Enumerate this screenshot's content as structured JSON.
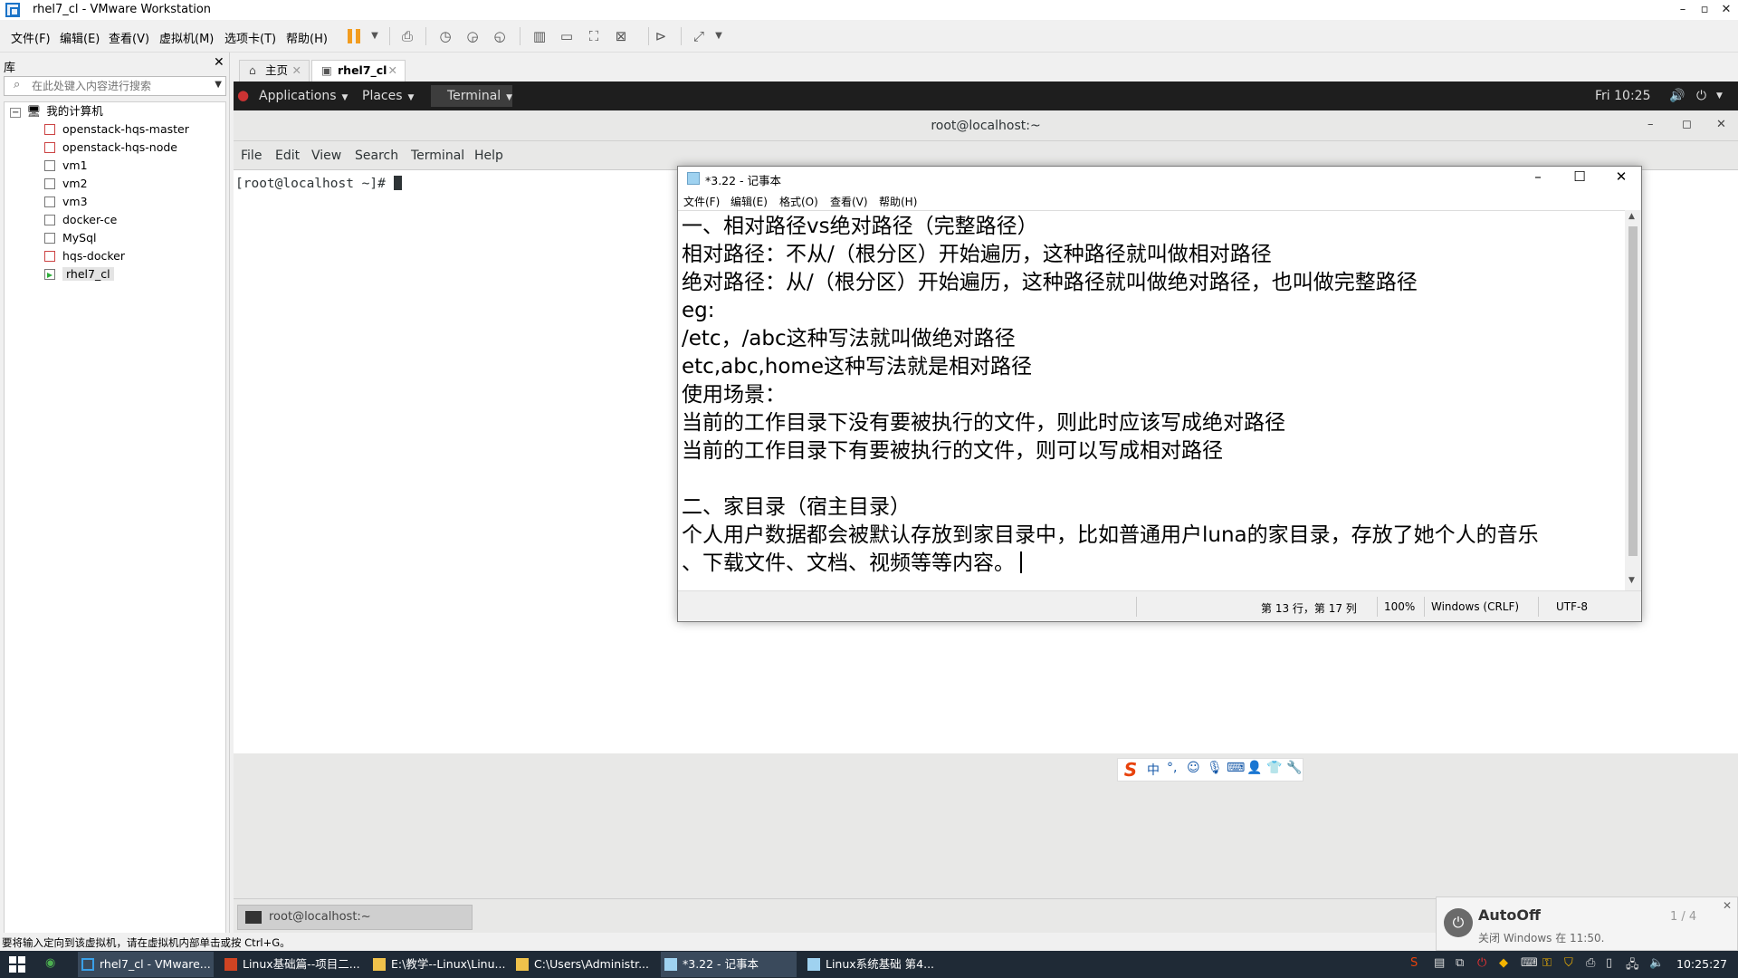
{
  "window": {
    "title": "rhel7_cl - VMware Workstation"
  },
  "menubar": [
    "文件(F)",
    "编辑(E)",
    "查看(V)",
    "虚拟机(M)",
    "选项卡(T)",
    "帮助(H)"
  ],
  "library": {
    "title": "库",
    "search_placeholder": "在此处键入内容进行搜索",
    "root": "我的计算机",
    "vms": [
      "openstack-hqs-master",
      "openstack-hqs-node",
      "vm1",
      "vm2",
      "vm3",
      "docker-ce",
      "MySql",
      "hqs-docker",
      "rhel7_cl"
    ]
  },
  "tabs": {
    "home": "主页",
    "vm": "rhel7_cl"
  },
  "gnome": {
    "applications": "Applications",
    "places": "Places",
    "terminal": "Terminal",
    "clock": "Fri 10:25"
  },
  "terminal": {
    "title": "root@localhost:~",
    "menu": [
      "File",
      "Edit",
      "View",
      "Search",
      "Terminal",
      "Help"
    ],
    "prompt": "[root@localhost ~]# "
  },
  "notepad": {
    "title": "*3.22 - 记事本",
    "menu": [
      "文件(F)",
      "编辑(E)",
      "格式(O)",
      "查看(V)",
      "帮助(H)"
    ],
    "lines": [
      "一、相对路径vs绝对路径（完整路径）",
      "相对路径：不从/（根分区）开始遍历，这种路径就叫做相对路径",
      "绝对路径：从/（根分区）开始遍历，这种路径就叫做绝对路径，也叫做完整路径",
      "eg:",
      "/etc，/abc这种写法就叫做绝对路径",
      "etc,abc,home这种写法就是相对路径",
      "使用场景：",
      "当前的工作目录下没有要被执行的文件，则此时应该写成绝对路径",
      "当前的工作目录下有要被执行的文件，则可以写成相对路径",
      "",
      "二、家目录（宿主目录）",
      "个人用户数据都会被默认存放到家目录中，比如普通用户luna的家目录，存放了她个人的音乐",
      "、下载文件、文档、视频等等内容。"
    ],
    "status": {
      "position": "第 13 行，第 17 列",
      "zoom": "100%",
      "eol": "Windows (CRLF)",
      "encoding": "UTF-8"
    }
  },
  "guest_taskbar": {
    "item": "root@localhost:~"
  },
  "ime": {
    "mode": "中"
  },
  "vm_status": "要将输入定向到该虚拟机，请在虚拟机内部单击或按 Ctrl+G。",
  "notification": {
    "title": "AutoOff",
    "subtitle": "关闭 Windows 在 11:50.",
    "page": "1 / 4"
  },
  "taskbar": {
    "apps": [
      "rhel7_cl - VMware...",
      "Linux基础篇--项目二...",
      "E:\\教学--Linux\\Linu...",
      "C:\\Users\\Administr...",
      "*3.22 - 记事本",
      "Linux系统基础 第4..."
    ],
    "clock": "10:25:27"
  },
  "colors": {
    "accent": "#1a73c8",
    "gnome_bar": "#1e1e1e",
    "taskbar": "#1f2a36",
    "pause": "#f29c1f"
  }
}
